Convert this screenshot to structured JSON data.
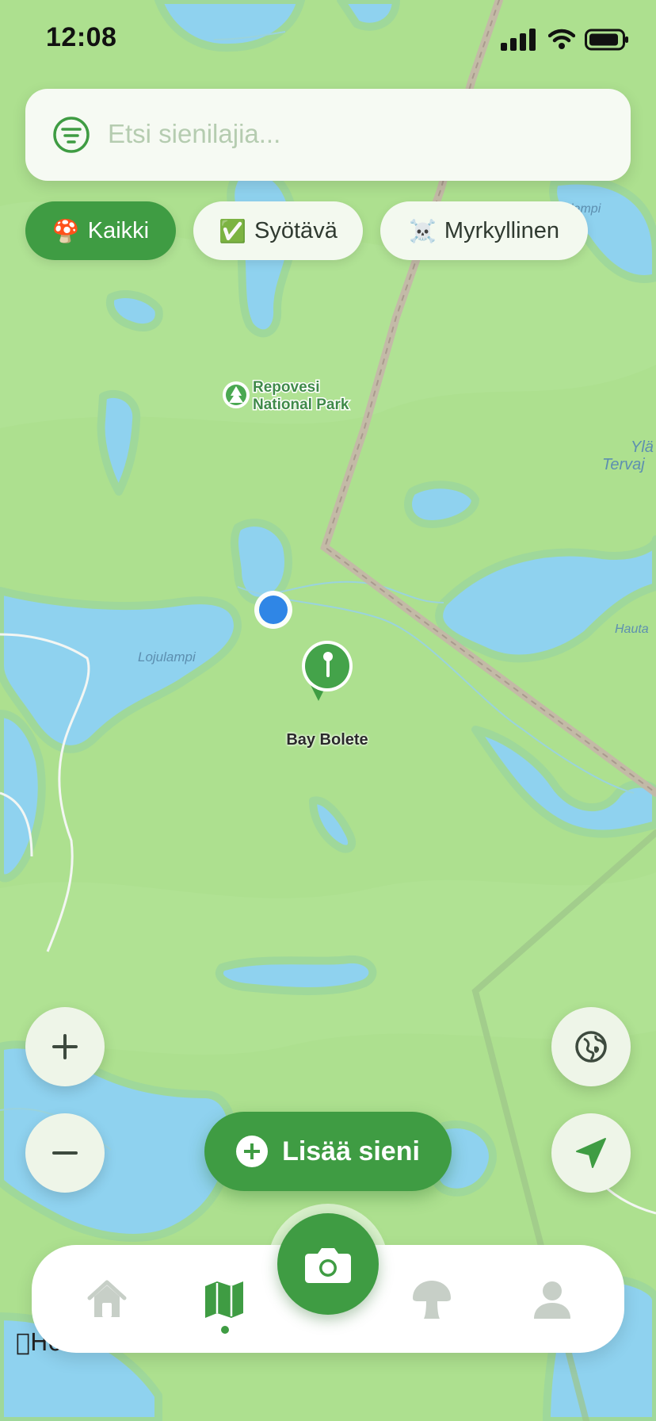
{
  "status_bar": {
    "time": "12:08"
  },
  "search": {
    "placeholder": "Etsi sienilajia..."
  },
  "filters": [
    {
      "emoji": "🍄",
      "label": "Kaikki",
      "active": true
    },
    {
      "emoji": "✅",
      "label": "Syötävä",
      "active": false
    },
    {
      "emoji": "☠️",
      "label": "Myrkyllinen",
      "active": false
    }
  ],
  "map": {
    "poi_name_line1": "Repovesi",
    "poi_name_line2": "National Park",
    "lake_labels": [
      "Lojulampi",
      "Kotlampi",
      "Ylä",
      "Tervaj",
      "Hauta"
    ],
    "pin_label": "Bay Bolete",
    "attribution": "Ho"
  },
  "actions": {
    "add_label": "Lisää sieni"
  },
  "tab_bar": {
    "tabs": [
      "home",
      "map",
      "camera",
      "mushroom",
      "profile"
    ],
    "active": "map"
  },
  "colors": {
    "accent": "#3f9c43",
    "land": "#a9d98e",
    "water": "#8fd2ef",
    "user_location": "#2f86e6"
  },
  "icons": {
    "search": "filter-lines-icon",
    "zoom_in": "plus-icon",
    "zoom_out": "minus-icon",
    "map_type": "globe-icon",
    "locate": "navigation-arrow-icon",
    "camera": "camera-icon"
  }
}
